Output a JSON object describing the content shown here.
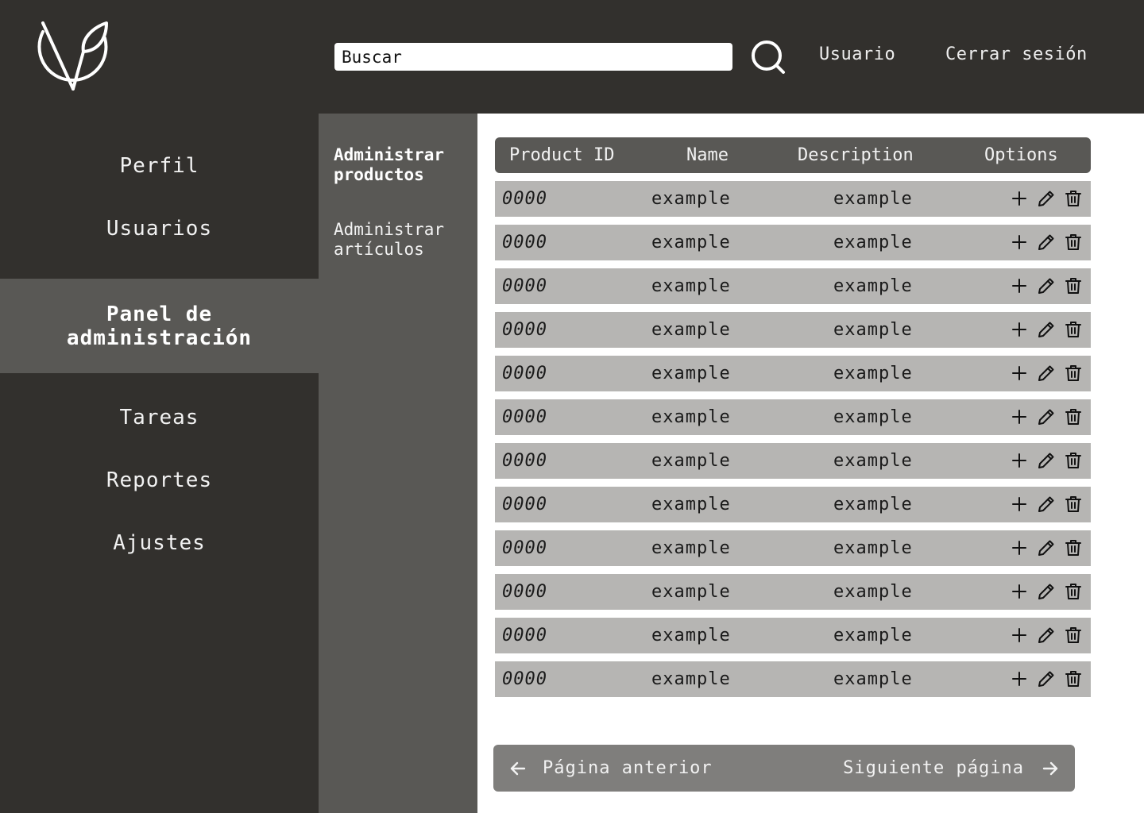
{
  "header": {
    "search_placeholder": "Buscar",
    "user_link": "Usuario",
    "logout_link": "Cerrar sesión"
  },
  "sidebar": {
    "items": [
      {
        "label": "Perfil"
      },
      {
        "label": "Usuarios"
      },
      {
        "label": "Panel de administración",
        "active": true
      },
      {
        "label": "Tareas"
      },
      {
        "label": "Reportes"
      },
      {
        "label": "Ajustes"
      }
    ]
  },
  "subnav": {
    "items": [
      {
        "label": "Administrar productos",
        "active": true
      },
      {
        "label": "Administrar artículos"
      }
    ]
  },
  "table": {
    "columns": [
      "Product ID",
      "Name",
      "Description",
      "Options"
    ],
    "rows": [
      {
        "id": "0000",
        "name": "example",
        "description": "example"
      },
      {
        "id": "0000",
        "name": "example",
        "description": "example"
      },
      {
        "id": "0000",
        "name": "example",
        "description": "example"
      },
      {
        "id": "0000",
        "name": "example",
        "description": "example"
      },
      {
        "id": "0000",
        "name": "example",
        "description": "example"
      },
      {
        "id": "0000",
        "name": "example",
        "description": "example"
      },
      {
        "id": "0000",
        "name": "example",
        "description": "example"
      },
      {
        "id": "0000",
        "name": "example",
        "description": "example"
      },
      {
        "id": "0000",
        "name": "example",
        "description": "example"
      },
      {
        "id": "0000",
        "name": "example",
        "description": "example"
      },
      {
        "id": "0000",
        "name": "example",
        "description": "example"
      },
      {
        "id": "0000",
        "name": "example",
        "description": "example"
      }
    ],
    "row_actions": [
      "plus-icon",
      "pencil-icon",
      "trash-icon"
    ]
  },
  "pagination": {
    "prev_label": "Página anterior",
    "next_label": "Siguiente página"
  },
  "icons": {
    "logo": "leaf-v-logo",
    "search": "search-icon",
    "prev": "arrow-left-icon",
    "next": "arrow-right-icon"
  },
  "colors": {
    "header_bg": "#32302d",
    "panel_bg": "#595855",
    "row_bg": "#b6b5b3",
    "pager_bg": "#7f7e7c"
  }
}
